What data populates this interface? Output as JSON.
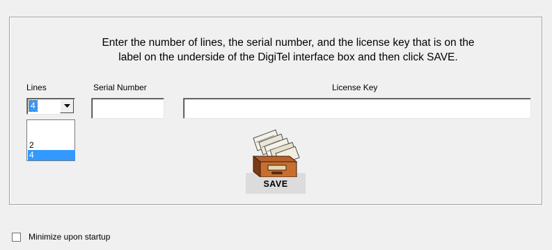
{
  "instructions": {
    "line1": "Enter the number of lines, the serial number, and the license key that is on the",
    "line2": "label on the underside of the DigiTel interface box and then click SAVE."
  },
  "fields": {
    "lines_label": "Lines",
    "lines_value": "4",
    "serial_label": "Serial Number",
    "serial_value": "",
    "license_label": "License Key",
    "license_value": ""
  },
  "lines_dropdown": {
    "options": [
      "2",
      "4"
    ],
    "selected": "4"
  },
  "save_button": {
    "label": "SAVE",
    "icon": "card-file-drawer-icon"
  },
  "minimize_option": {
    "label": "Minimize upon startup",
    "checked": false
  },
  "colors": {
    "selection": "#3399ff",
    "window_bg": "#f0f0f0"
  }
}
